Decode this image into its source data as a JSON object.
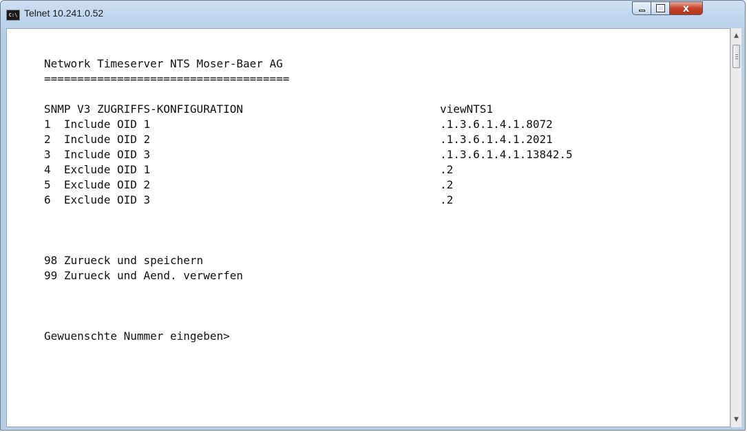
{
  "window": {
    "title": "Telnet 10.241.0.52",
    "app_icon_text": "C:\\"
  },
  "controls": {
    "minimize": "minimize",
    "maximize": "maximize",
    "close": "x"
  },
  "console": {
    "header": "Network Timeserver NTS Moser-Baer AG",
    "separator": "=====================================",
    "section_title": "SNMP V3 ZUGRIFFS-KONFIGURATION",
    "section_value": "viewNTS1",
    "items": [
      {
        "label": "1  Include OID 1",
        "value": ".1.3.6.1.4.1.8072"
      },
      {
        "label": "2  Include OID 2",
        "value": ".1.3.6.1.4.1.2021"
      },
      {
        "label": "3  Include OID 3",
        "value": ".1.3.6.1.4.1.13842.5"
      },
      {
        "label": "4  Exclude OID 1",
        "value": ".2"
      },
      {
        "label": "5  Exclude OID 2",
        "value": ".2"
      },
      {
        "label": "6  Exclude OID 3",
        "value": ".2"
      }
    ],
    "option_save": "98 Zurueck und speichern",
    "option_discard": "99 Zurueck und Aend. verwerfen",
    "prompt": "Gewuenschte Nummer eingeben>"
  }
}
